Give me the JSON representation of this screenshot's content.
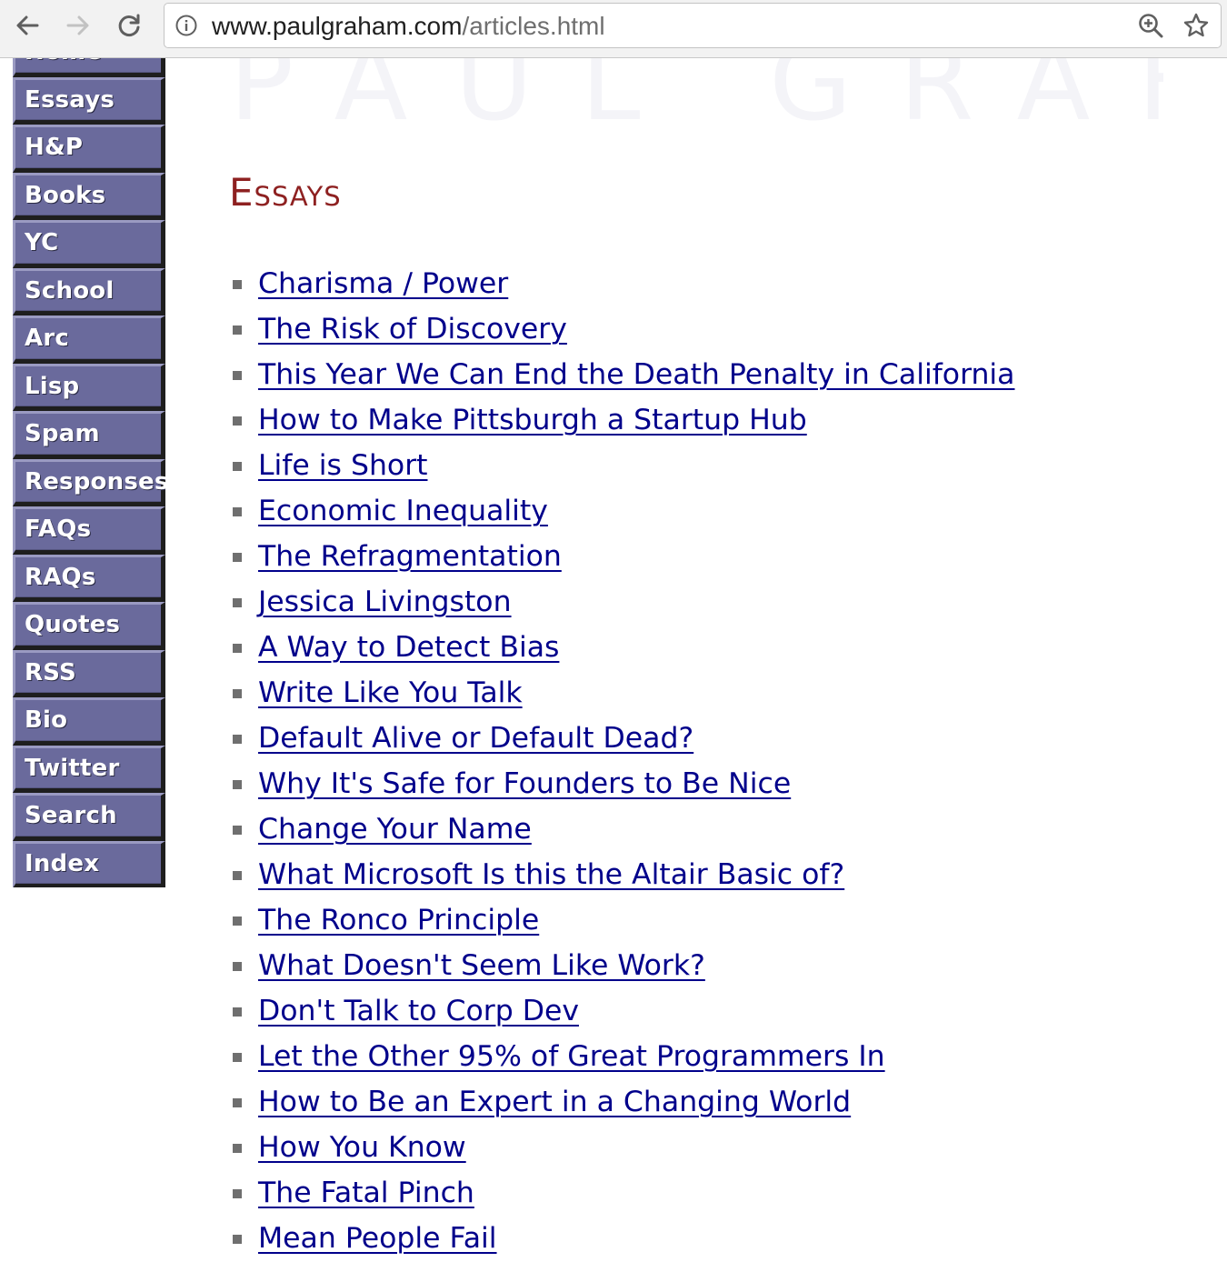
{
  "browser": {
    "url_host": "www.paulgraham.com",
    "url_path": "/articles.html",
    "back_icon": "arrow-left-icon",
    "forward_icon": "arrow-right-icon",
    "reload_icon": "reload-icon",
    "site_info_icon": "info-icon",
    "zoom_icon": "zoom-in-icon",
    "bookmark_icon": "star-icon"
  },
  "banner": {
    "text": "PAUL GRAHAM"
  },
  "sidebar": {
    "items": [
      {
        "label": "Home"
      },
      {
        "label": "Essays"
      },
      {
        "label": "H&P"
      },
      {
        "label": "Books"
      },
      {
        "label": "YC"
      },
      {
        "label": "School"
      },
      {
        "label": "Arc"
      },
      {
        "label": "Lisp"
      },
      {
        "label": "Spam"
      },
      {
        "label": "Responses"
      },
      {
        "label": "FAQs"
      },
      {
        "label": "RAQs"
      },
      {
        "label": "Quotes"
      },
      {
        "label": "RSS"
      },
      {
        "label": "Bio"
      },
      {
        "label": "Twitter"
      },
      {
        "label": "Search"
      },
      {
        "label": "Index"
      }
    ]
  },
  "main": {
    "heading": "Essays",
    "essays": [
      {
        "title": "Charisma / Power"
      },
      {
        "title": "The Risk of Discovery"
      },
      {
        "title": "This Year We Can End the Death Penalty in California"
      },
      {
        "title": "How to Make Pittsburgh a Startup Hub"
      },
      {
        "title": "Life is Short"
      },
      {
        "title": "Economic Inequality"
      },
      {
        "title": "The Refragmentation"
      },
      {
        "title": "Jessica Livingston"
      },
      {
        "title": "A Way to Detect Bias"
      },
      {
        "title": "Write Like You Talk"
      },
      {
        "title": "Default Alive or Default Dead?"
      },
      {
        "title": "Why It's Safe for Founders to Be Nice"
      },
      {
        "title": "Change Your Name"
      },
      {
        "title": "What Microsoft Is this the Altair Basic of?"
      },
      {
        "title": "The Ronco Principle"
      },
      {
        "title": "What Doesn't Seem Like Work?"
      },
      {
        "title": "Don't Talk to Corp Dev"
      },
      {
        "title": "Let the Other 95% of Great Programmers In"
      },
      {
        "title": "How to Be an Expert in a Changing World"
      },
      {
        "title": "How You Know"
      },
      {
        "title": "The Fatal Pinch"
      },
      {
        "title": "Mean People Fail"
      }
    ]
  },
  "colors": {
    "nav_button": "#6a6a9c",
    "link": "#00008b",
    "heading": "#8e2121"
  }
}
